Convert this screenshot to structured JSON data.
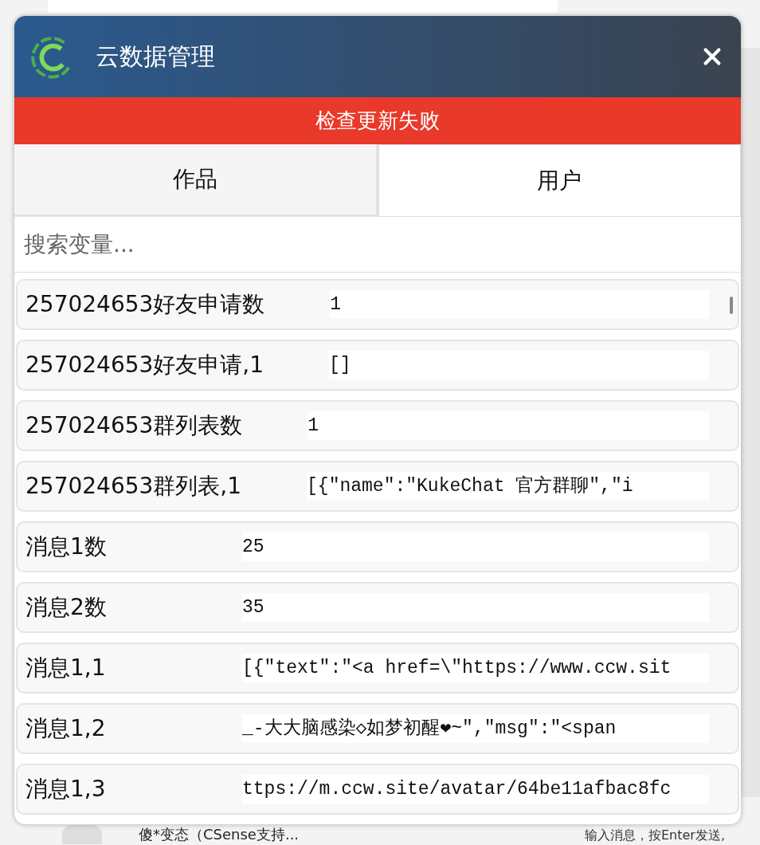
{
  "background": {
    "chat_item": "傻*变态（CSense支持...",
    "message_input": {
      "placeholder": "输入消息，按Enter发送,"
    }
  },
  "dialog": {
    "title": "云数据管理",
    "error_banner": "检查更新失败",
    "tabs": [
      {
        "label": "作品",
        "selected": true
      },
      {
        "label": "用户",
        "selected": false
      }
    ],
    "search": {
      "placeholder": "搜索变量..."
    },
    "variables": [
      {
        "name": "257024653好友申请数",
        "value": "1"
      },
      {
        "name": "257024653好友申请,1",
        "value": "[]"
      },
      {
        "name": "257024653群列表数",
        "value": "1"
      },
      {
        "name": "257024653群列表,1",
        "value": "[{\"name\":\"KukeChat 官方群聊\",\"i"
      },
      {
        "name": "消息1数",
        "value": "25"
      },
      {
        "name": "消息2数",
        "value": "35"
      },
      {
        "name": "消息1,1",
        "value": "[{\"text\":\"<a href=\\\"https://www.ccw.sit"
      },
      {
        "name": "消息1,2",
        "value": "_-大大脑感染◇如梦初醒❤~\",\"msg\":\"<span"
      },
      {
        "name": "消息1,3",
        "value": "ttps://m.ccw.site/avatar/64be11afbac8fc"
      }
    ]
  }
}
